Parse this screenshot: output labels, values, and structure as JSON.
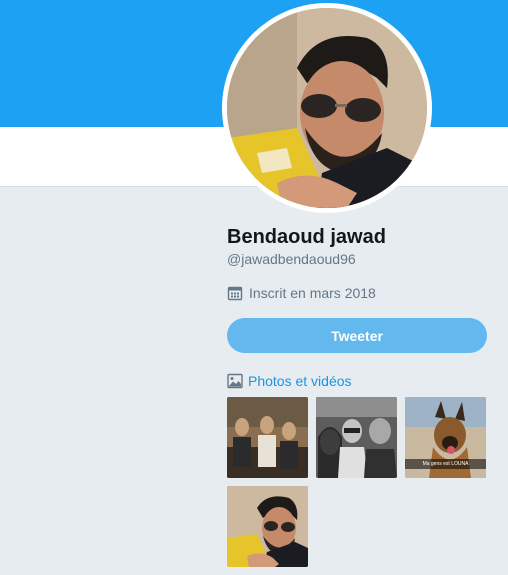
{
  "profile": {
    "name": "Bendaoud jawad",
    "handle": "@jawadbendaoud96",
    "joined": "Inscrit en mars 2018",
    "avatar_alt": "profile-avatar"
  },
  "actions": {
    "tweet_label": "Tweeter"
  },
  "media": {
    "link_label": "Photos et vidéos",
    "thumbnails": [
      {
        "name": "photo-group-cafe"
      },
      {
        "name": "photo-friends-selfie"
      },
      {
        "name": "photo-dog-beach",
        "caption": "Ma gens est LOUNA"
      },
      {
        "name": "photo-profile-selfie"
      }
    ]
  },
  "colors": {
    "banner": "#1da1f2",
    "page_background": "#e6ecf0",
    "button": "#63b8ee",
    "link": "#1b95e0",
    "muted_text": "#657786"
  },
  "icons": {
    "calendar": "calendar-icon",
    "media": "image-icon"
  }
}
